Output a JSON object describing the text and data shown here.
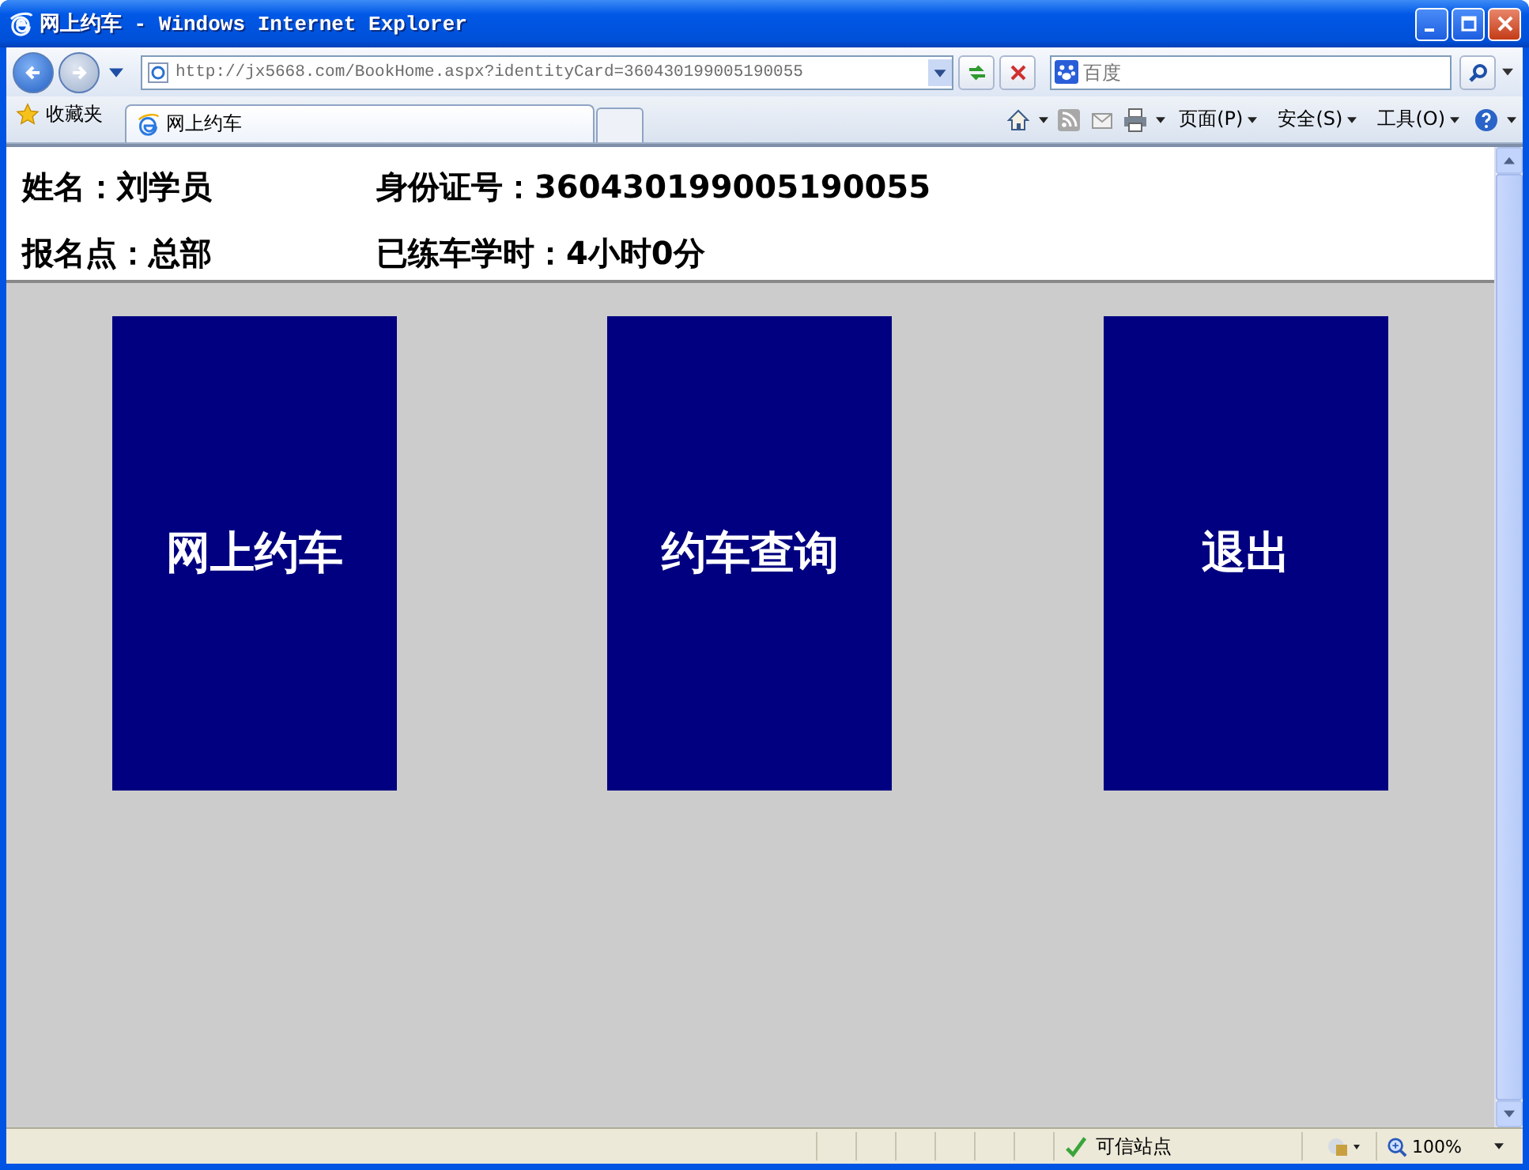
{
  "window": {
    "title": "网上约车 - Windows Internet Explorer"
  },
  "address_bar": {
    "url": "http://jx5668.com/BookHome.aspx?identityCard=360430199005190055"
  },
  "search": {
    "placeholder": "百度"
  },
  "favorites": {
    "label": "收藏夹"
  },
  "tabs": [
    {
      "label": "网上约车",
      "selected": true
    }
  ],
  "command_bar": [
    {
      "label": "页面(P)"
    },
    {
      "label": "安全(S)"
    },
    {
      "label": "工具(O)"
    }
  ],
  "info_rows": [
    [
      "姓名：刘学员",
      "身份证号：360430199005190055"
    ],
    [
      "报名点：总部",
      "已练车学时：4小时0分"
    ]
  ],
  "menu_tiles": [
    {
      "label": "网上约车"
    },
    {
      "label": "约车查询"
    },
    {
      "label": "退出"
    }
  ],
  "status_bar": {
    "zone": "可信站点",
    "zoom": "100%"
  }
}
